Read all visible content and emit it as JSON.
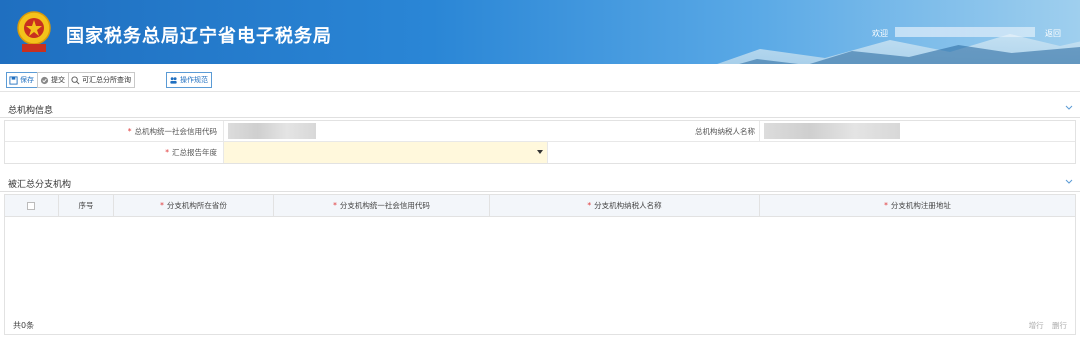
{
  "header": {
    "title": "国家税务总局辽宁省电子税务局",
    "welcome": "欢迎",
    "back": "返回",
    "logo_icon": "tax-emblem-icon"
  },
  "toolbar": {
    "buttons": [
      {
        "label": "保存",
        "icon": "save-icon"
      },
      {
        "label": "提交",
        "icon": "submit-icon"
      },
      {
        "label": "可汇总分所查询",
        "icon": "search-icon"
      },
      {
        "label": "操作规范",
        "icon": "people-icon"
      }
    ]
  },
  "sections": {
    "head_org": "总机构信息",
    "branches": "被汇总分支机构"
  },
  "form": {
    "credit_code_label": "总机构统一社会信用代码",
    "taxpayer_name_label": "总机构纳税人名称",
    "report_year_label": "汇总报告年度",
    "required_mark": "*"
  },
  "table": {
    "columns": [
      "序号",
      "分支机构所在省份",
      "分支机构统一社会信用代码",
      "分支机构纳税人名称",
      "分支机构注册地址"
    ],
    "rows": [],
    "count": "共0条",
    "add_row": "增行",
    "delete_row": "删行"
  },
  "colors": {
    "header_blue": "#1f6fc0",
    "required_red": "#e03a3a",
    "input_highlight": "#fff8dc"
  }
}
